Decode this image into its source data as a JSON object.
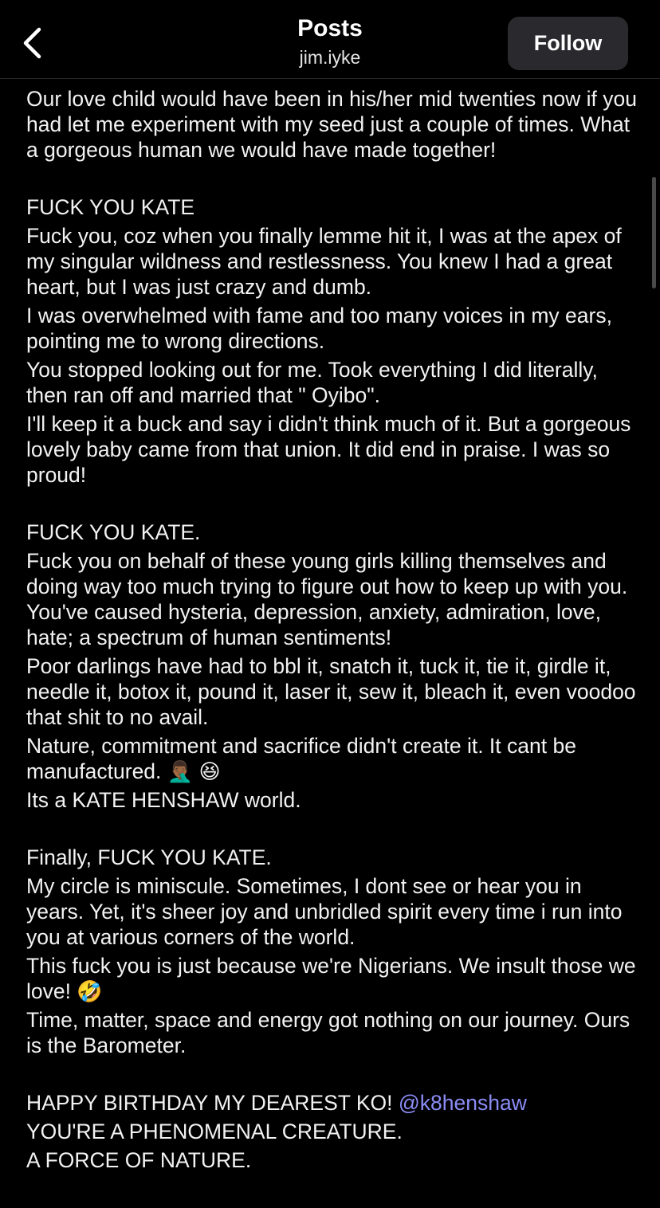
{
  "header": {
    "title": "Posts",
    "username": "jim.iyke",
    "follow_label": "Follow",
    "back_icon": "chevron-left-icon"
  },
  "post": {
    "p1": "Our love child would have been in his/her mid twenties now if you had let me experiment with my seed just a couple of times. What a gorgeous human we would have made together!",
    "h2": "FUCK YOU KATE",
    "p2a": "Fuck you, coz when you finally lemme hit it, I was at the apex of my singular wildness and restlessness. You knew I had a great heart, but I was just crazy and dumb.",
    "p2b": "I was overwhelmed with fame and too many voices in my ears, pointing me to wrong directions.",
    "p2c": "You stopped looking out for me. Took everything I did literally, then ran off and married that \" Oyibo\".",
    "p2d": "I'll keep it a buck and say i didn't think much of it. But a gorgeous lovely baby came from that union. It did end in praise. I was so proud!",
    "h3": "FUCK YOU KATE.",
    "p3a": "Fuck you on behalf of these young girls killing themselves and doing way too much trying to figure out how to keep up with you. You've caused hysteria, depression, anxiety, admiration, love, hate; a spectrum of human sentiments!",
    "p3b": "Poor darlings have had to bbl it, snatch it, tuck it, tie it, girdle it, needle it, botox it, pound it, laser it, sew it, bleach it, even voodoo that shit to no avail.",
    "p3c": "Nature, commitment and sacrifice didn't create it. It cant be manufactured.",
    "p3c_emoji1": "🤦🏾‍♂️",
    "p3c_emoji2": "😆",
    "p3d": "Its a KATE HENSHAW world.",
    "h4": "Finally, FUCK YOU KATE.",
    "p4a": "My circle is miniscule. Sometimes, I dont see or hear you in years. Yet, it's sheer joy and unbridled spirit every time i run into you at various corners of the world.",
    "p4b": "This fuck you is just because we're Nigerians. We insult those we love!",
    "p4b_emoji": "🤣",
    "p4c": "Time, matter, space and energy got nothing on our journey. Ours is the Barometer.",
    "p5a": "HAPPY BIRTHDAY MY DEAREST KO!",
    "mention": "@k8henshaw",
    "p5b": "YOU'RE A PHENOMENAL CREATURE.",
    "p5c": "A FORCE OF NATURE."
  },
  "colors": {
    "background": "#000000",
    "text": "#f2f2f2",
    "mention": "#8b8cf5",
    "follow_button": "#2a2a2e"
  }
}
